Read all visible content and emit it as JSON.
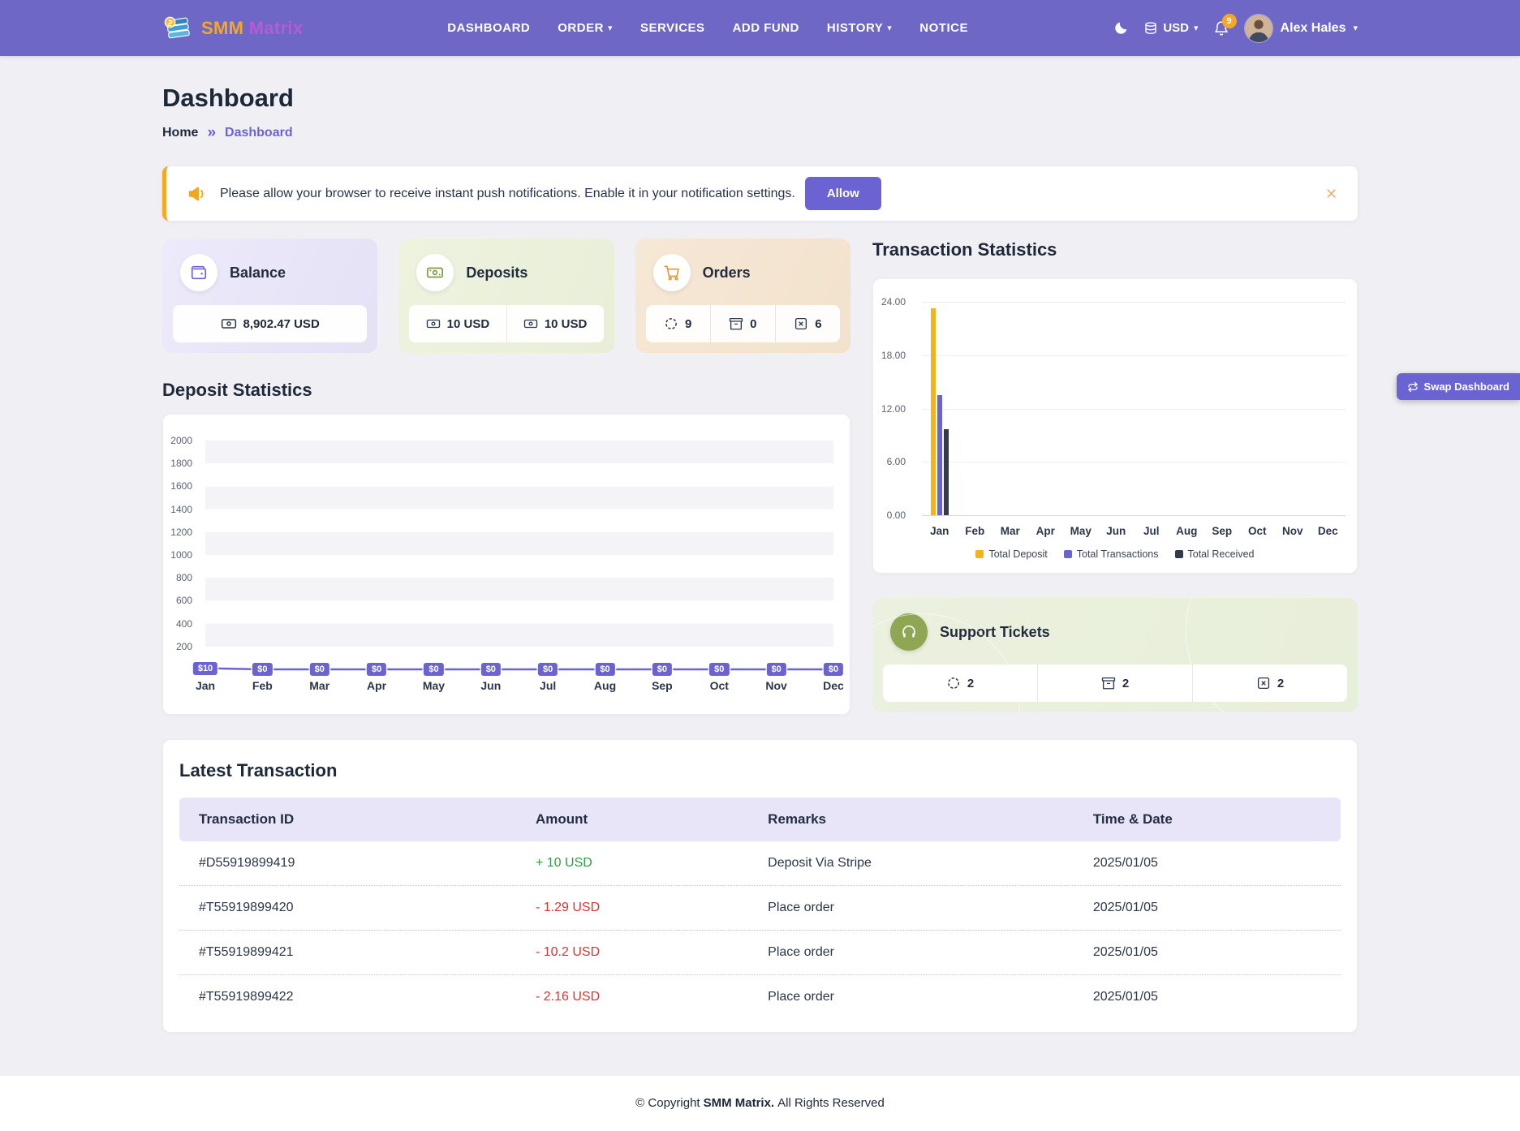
{
  "colors": {
    "navbar": "#6e67c5",
    "accent": "#6c63d2",
    "positive": "#2f9e44",
    "negative": "#e03131",
    "warning": "#f6a723"
  },
  "navbar": {
    "logo": {
      "part1": "SMM",
      "part2": "Matrix"
    },
    "links": [
      {
        "label": "DASHBOARD",
        "dropdown": false
      },
      {
        "label": "ORDER",
        "dropdown": true
      },
      {
        "label": "SERVICES",
        "dropdown": false
      },
      {
        "label": "ADD FUND",
        "dropdown": false
      },
      {
        "label": "HISTORY",
        "dropdown": true
      },
      {
        "label": "NOTICE",
        "dropdown": false
      }
    ],
    "currency": "USD",
    "notification_count": "9",
    "user_name": "Alex Hales"
  },
  "page": {
    "title": "Dashboard",
    "breadcrumb_home": "Home",
    "breadcrumb_current": "Dashboard"
  },
  "alert": {
    "message": "Please allow your browser to receive instant push notifications. Enable it in your notification settings.",
    "allow_label": "Allow"
  },
  "stats": {
    "balance": {
      "title": "Balance",
      "value": "8,902.47 USD"
    },
    "deposits": {
      "title": "Deposits",
      "value1": "10 USD",
      "value2": "10 USD"
    },
    "orders": {
      "title": "Orders",
      "processing": "9",
      "completed": "0",
      "cancelled": "6"
    }
  },
  "sections": {
    "transaction_statistics": "Transaction Statistics",
    "deposit_statistics": "Deposit Statistics",
    "support_tickets": "Support Tickets",
    "latest_transaction": "Latest Transaction"
  },
  "support": {
    "pending": "2",
    "answered": "2",
    "closed": "2"
  },
  "chart_data": [
    {
      "name": "deposit_statistics",
      "type": "line",
      "title": "Deposit Statistics",
      "categories": [
        "Jan",
        "Feb",
        "Mar",
        "Apr",
        "May",
        "Jun",
        "Jul",
        "Aug",
        "Sep",
        "Oct",
        "Nov",
        "Dec"
      ],
      "values": [
        10,
        0,
        0,
        0,
        0,
        0,
        0,
        0,
        0,
        0,
        0,
        0
      ],
      "labels": [
        "$10",
        "$0",
        "$0",
        "$0",
        "$0",
        "$0",
        "$0",
        "$0",
        "$0",
        "$0",
        "$0",
        "$0"
      ],
      "ylim": [
        0,
        2000
      ],
      "yticks": [
        2000,
        1800,
        1600,
        1400,
        1200,
        1000,
        800,
        600,
        400,
        200
      ],
      "line_color": "#6c63d2",
      "grid": "striped-bands",
      "legend_position": "none"
    },
    {
      "name": "transaction_statistics",
      "type": "bar",
      "title": "Transaction Statistics",
      "categories": [
        "Jan",
        "Feb",
        "Mar",
        "Apr",
        "May",
        "Jun",
        "Jul",
        "Aug",
        "Sep",
        "Oct",
        "Nov",
        "Dec"
      ],
      "series": [
        {
          "name": "Total Deposit",
          "color": "#f2b31b",
          "values": [
            23.3,
            0,
            0,
            0,
            0,
            0,
            0,
            0,
            0,
            0,
            0,
            0
          ]
        },
        {
          "name": "Total Transactions",
          "color": "#6c63d2",
          "values": [
            13.5,
            0,
            0,
            0,
            0,
            0,
            0,
            0,
            0,
            0,
            0,
            0
          ]
        },
        {
          "name": "Total Received",
          "color": "#333b4a",
          "values": [
            9.7,
            0,
            0,
            0,
            0,
            0,
            0,
            0,
            0,
            0,
            0,
            0
          ]
        }
      ],
      "ylim": [
        0,
        24
      ],
      "yticks": [
        "24.00",
        "18.00",
        "12.00",
        "6.00",
        "0.00"
      ],
      "grid": "horizontal",
      "legend_position": "bottom"
    }
  ],
  "table": {
    "headers": [
      "Transaction ID",
      "Amount",
      "Remarks",
      "Time & Date"
    ],
    "rows": [
      {
        "id": "#D55919899419",
        "amount": "+ 10 USD",
        "amount_type": "positive",
        "remarks": "Deposit Via Stripe",
        "date": "2025/01/05"
      },
      {
        "id": "#T55919899420",
        "amount": "- 1.29 USD",
        "amount_type": "negative",
        "remarks": "Place order",
        "date": "2025/01/05"
      },
      {
        "id": "#T55919899421",
        "amount": "- 10.2 USD",
        "amount_type": "negative",
        "remarks": "Place order",
        "date": "2025/01/05"
      },
      {
        "id": "#T55919899422",
        "amount": "- 2.16 USD",
        "amount_type": "negative",
        "remarks": "Place order",
        "date": "2025/01/05"
      }
    ]
  },
  "floating": {
    "swap_label": "Swap Dashboard"
  },
  "footer": {
    "prefix": "© Copyright",
    "brand": "SMM Matrix.",
    "suffix": "All Rights Reserved"
  }
}
